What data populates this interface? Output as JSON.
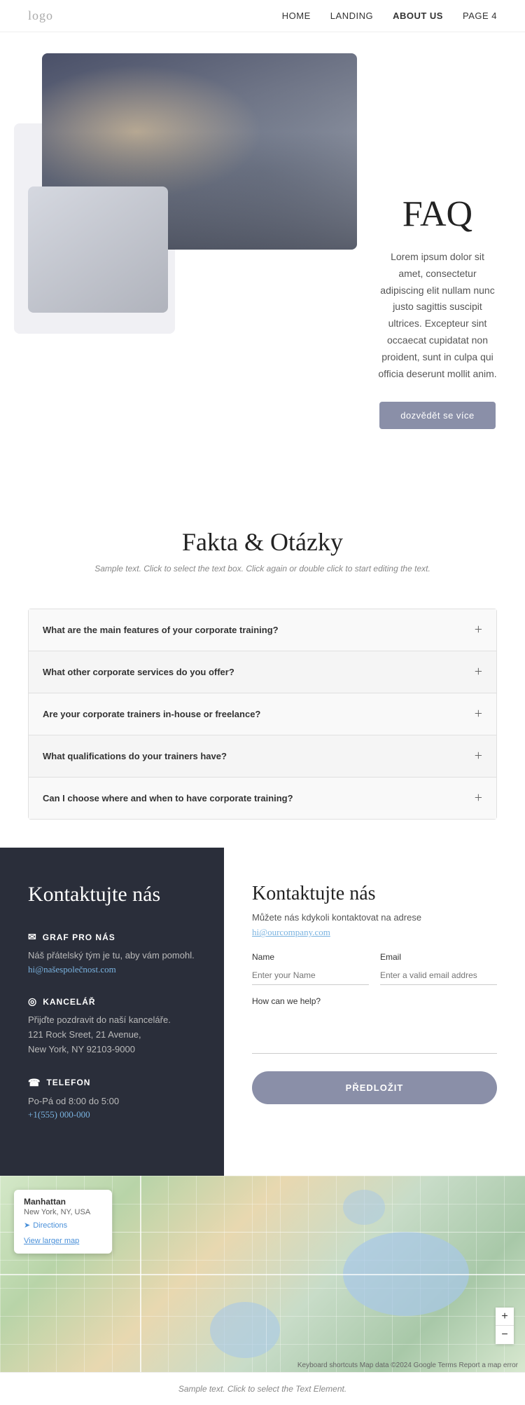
{
  "nav": {
    "logo": "logo",
    "links": [
      {
        "label": "HOME",
        "active": false
      },
      {
        "label": "LANDING",
        "active": false
      },
      {
        "label": "ABOUT US",
        "active": true
      },
      {
        "label": "PAGE 4",
        "active": false
      }
    ]
  },
  "hero": {
    "title": "FAQ",
    "description": "Lorem ipsum dolor sit amet, consectetur adipiscing elit nullam nunc justo sagittis suscipit ultrices. Excepteur sint occaecat cupidatat non proident, sunt in culpa qui officia deserunt mollit anim.",
    "button_label": "dozvědět se více"
  },
  "faq_section": {
    "title": "Fakta & Otázky",
    "subtitle": "Sample text. Click to select the text box. Click again or double click to start editing the text.",
    "items": [
      {
        "question": "What are the main features of your corporate training?"
      },
      {
        "question": "What other corporate services do you offer?"
      },
      {
        "question": "Are your corporate trainers in-house or freelance?"
      },
      {
        "question": "What qualifications do your trainers have?"
      },
      {
        "question": "Can I choose where and when to have corporate training?"
      }
    ]
  },
  "contact_left": {
    "title": "Kontaktujte nás",
    "email_label": "GRAF PRO NÁS",
    "email_desc": "Náš přátelský tým je tu, aby vám pomohl.",
    "email_link": "hi@našespolečnost.com",
    "office_label": "KANCELÁŘ",
    "office_desc": "Přijďte pozdravit do naší kanceláře.\n121 Rock Sreet, 21 Avenue,\nNew York, NY 92103-9000",
    "phone_label": "TELEFON",
    "phone_hours": "Po-Pá od 8:00 do 5:00",
    "phone_number": "+1(555) 000-000"
  },
  "contact_right": {
    "title": "Kontaktujte nás",
    "subtitle": "Můžete nás kdykoli kontaktovat na adrese",
    "email": "hi@ourcompany.com",
    "name_label": "Name",
    "name_placeholder": "Enter your Name",
    "email_label": "Email",
    "email_placeholder": "Enter a valid email addres",
    "help_label": "How can we help?",
    "submit_label": "PŘEDLOŽIT"
  },
  "map": {
    "location": "Manhattan",
    "location_sub": "New York, NY, USA",
    "directions_label": "Directions",
    "view_larger": "View larger map",
    "footer_text": "Keyboard shortcuts  Map data ©2024 Google  Terms  Report a map error"
  },
  "bottom": {
    "sample_text": "Sample text. Click to select the Text Element."
  }
}
